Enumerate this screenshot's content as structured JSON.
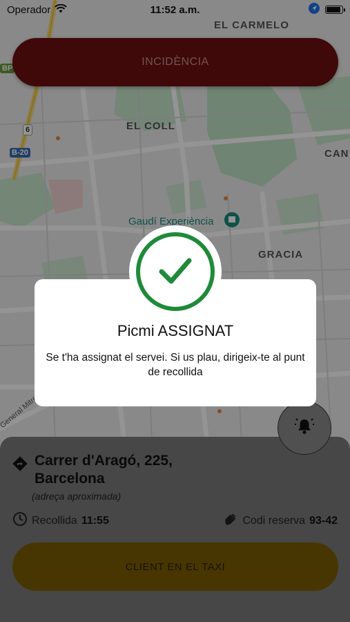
{
  "status_bar": {
    "carrier": "Operador",
    "time": "11:52 a.m.",
    "battery_level": 0.95
  },
  "map": {
    "labels": {
      "el_carmelo": "EL CARMELO",
      "el_coll": "EL COLL",
      "can": "CAN",
      "gracia": "GRACIA",
      "general_mitre": "General Mitre",
      "poi": "Gaudí Experiència"
    },
    "shields": {
      "bp": "BP",
      "b20": "B-20",
      "six": "6"
    }
  },
  "top": {
    "incidence_label": "INCIDÈNCIA"
  },
  "modal": {
    "title": "Picmi ASSIGNAT",
    "body": "Se t'ha assignat el servei. Si us plau, dirigeix-te al punt de recollida",
    "icon": "check-icon",
    "accent": "#1f8a3a"
  },
  "trip": {
    "address": "Carrer d'Aragó, 225, Barcelona",
    "address_note": "(adreça aproximada)",
    "pickup_label": "Recollida",
    "pickup_time": "11:55",
    "booking_label": "Codi reserva",
    "booking_code": "93-42"
  },
  "actions": {
    "client_in_taxi_label": "CLIENT EN EL TAXI"
  },
  "colors": {
    "incidence": "#b3151c",
    "client_button": "#f0b90a",
    "success": "#1f8a3a"
  }
}
